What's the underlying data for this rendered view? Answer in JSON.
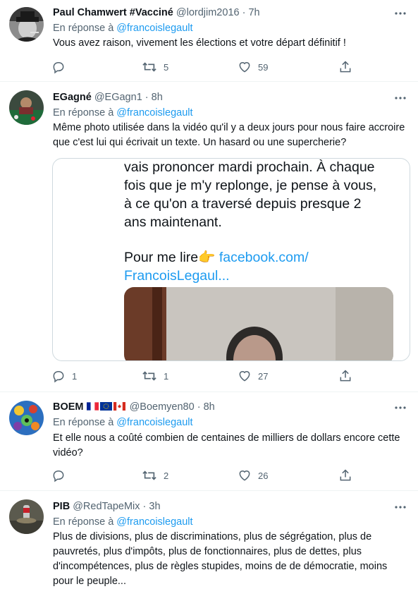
{
  "tweets": [
    {
      "name": "Paul Chamwert #Vacciné",
      "handle": "@lordjim2016",
      "time": "7h",
      "reply_prefix": "En réponse à",
      "reply_mention": "@francoislegault",
      "text": "Vous avez raison, vivement les élections et votre départ définitif !",
      "replies": "",
      "retweets": "5",
      "likes": "59"
    },
    {
      "name": "EGagné",
      "handle": "@EGagn1",
      "time": "8h",
      "reply_prefix": "En réponse à",
      "reply_mention": "@francoislegault",
      "text": "Même photo utilisée dans la vidéo qu'il y a deux jours pour nous faire accroire que c'est lui qui écrivait un texte. Un hasard ou une supercherie?",
      "media": {
        "line1": "vais prononcer mardi prochain. À chaque",
        "line2": "fois que je m'y replonge, je pense à vous,",
        "line3": "à ce qu'on a traversé depuis presque 2",
        "line4": "ans maintenant.",
        "link_prefix": "Pour me lire",
        "link_emoji": "👉",
        "link_text": " facebook.com/",
        "link_text2": "FrancoisLegaul..."
      },
      "replies": "1",
      "retweets": "1",
      "likes": "27"
    },
    {
      "name": "BOEM",
      "handle": "@Boemyen80",
      "time": "8h",
      "reply_prefix": "En réponse à",
      "reply_mention": "@francoislegault",
      "text": "Et elle nous a coûté combien de centaines de milliers de dollars encore cette vidéo?",
      "replies": "",
      "retweets": "2",
      "likes": "26"
    },
    {
      "name": "PIB",
      "handle": "@RedTapeMix",
      "time": "3h",
      "reply_prefix": "En réponse à",
      "reply_mention": "@francoislegault",
      "text": "Plus de divisions, plus de discriminations, plus de ségrégation, plus de pauvretés, plus d'impôts, plus de fonctionnaires, plus de dettes, plus d'incompétences, plus de règles stupides, moins de de démocratie, moins pour le peuple..."
    }
  ],
  "separator": " · ",
  "flags": [
    "france-flag",
    "eu-flag",
    "canada-flag"
  ],
  "colors": {
    "accent": "#1d9bf0",
    "secondary": "#536471",
    "border": "#eff3f4"
  }
}
